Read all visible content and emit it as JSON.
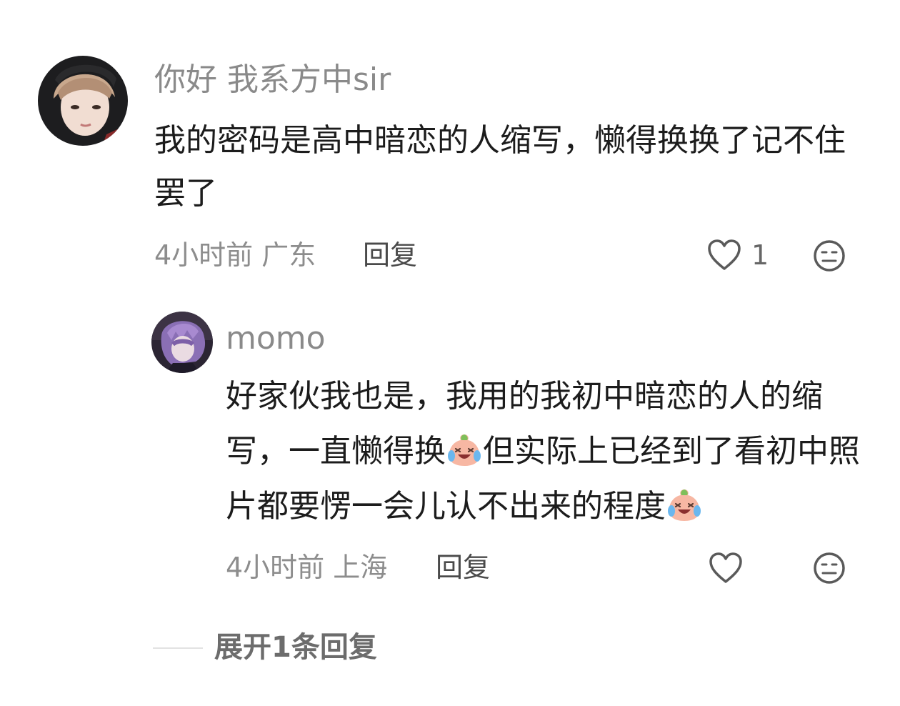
{
  "comment": {
    "username": "你好 我系方中sir",
    "text": "我的密码是高中暗恋的人缩写，懒得换换了记不住罢了",
    "time": "4小时前",
    "location": "广东",
    "reply_label": "回复",
    "like_count": "1",
    "icons": {
      "like": "heart-outline-icon",
      "dislike": "neutral-face-icon"
    }
  },
  "reply": {
    "username": "momo",
    "text_parts": [
      "好家伙我也是，我用的我初中暗恋的人的缩写，一直懒得换",
      "但实际上已经到了看初中照片都要愣一会儿认不出来的程度"
    ],
    "time": "4小时前",
    "location": "上海",
    "reply_label": "回复",
    "icons": {
      "emoji": "crying-laughing-peach-emoji",
      "like": "heart-outline-icon",
      "dislike": "neutral-face-icon"
    }
  },
  "expand_label": "展开1条回复",
  "colors": {
    "meta": "#8d8d8d",
    "text": "#1c1c1c",
    "reply_action": "#4a4a4a"
  }
}
